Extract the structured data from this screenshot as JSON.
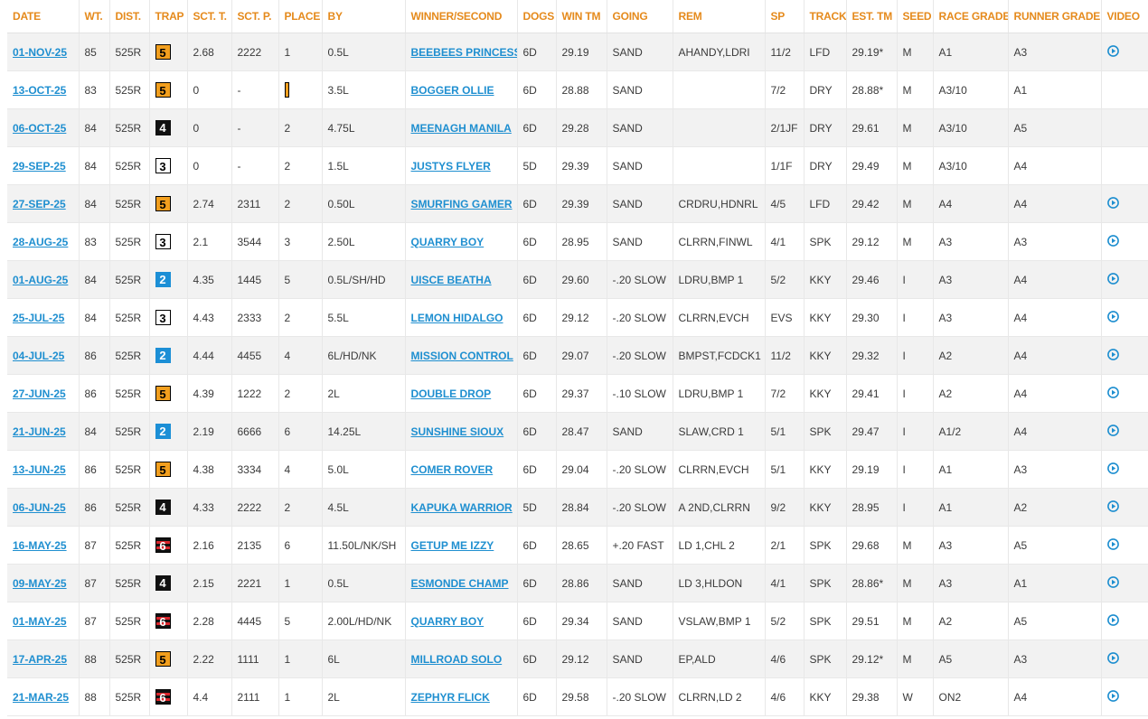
{
  "columns": [
    "DATE",
    "WT.",
    "DIST.",
    "TRAP",
    "SCT. T.",
    "SCT. P.",
    "PLACE",
    "BY",
    "WINNER/SECOND",
    "DOGS",
    "WIN TM",
    "GOING",
    "REM",
    "SP",
    "TRACK",
    "EST. TM",
    "SEED",
    "RACE GRADE",
    "RUNNER GRADE",
    "VIDEO"
  ],
  "colors": {
    "header": "#e58a1c",
    "link": "#1f8fd0",
    "video_icon": "#1f8fd0"
  },
  "rows": [
    {
      "date": "01-NOV-25",
      "wt": "85",
      "dist": "525R",
      "trap": "5",
      "sct_t": "2.68",
      "sct_p": "2222",
      "place": "1",
      "by": "0.5L",
      "winner": "BEEBEES PRINCESS",
      "dogs": "6D",
      "win_tm": "29.19",
      "going": "SAND",
      "rem": "AHANDY,LDRI",
      "sp": "11/2",
      "track": "LFD",
      "est_tm": "29.19*",
      "seed": "M",
      "race_grade": "A1",
      "runner_grade": "A3",
      "video": true
    },
    {
      "date": "13-OCT-25",
      "wt": "83",
      "dist": "525R",
      "trap": "5",
      "sct_t": "0",
      "sct_p": "-",
      "place": "",
      "place_icon": "partial-trap",
      "by": "3.5L",
      "winner": "BOGGER OLLIE",
      "dogs": "6D",
      "win_tm": "28.88",
      "going": "SAND",
      "rem": "",
      "sp": "7/2",
      "track": "DRY",
      "est_tm": "28.88*",
      "seed": "M",
      "race_grade": "A3/10",
      "runner_grade": "A1",
      "video": false
    },
    {
      "date": "06-OCT-25",
      "wt": "84",
      "dist": "525R",
      "trap": "4",
      "sct_t": "0",
      "sct_p": "-",
      "place": "2",
      "by": "4.75L",
      "winner": "MEENAGH MANILA",
      "dogs": "6D",
      "win_tm": "29.28",
      "going": "SAND",
      "rem": "",
      "sp": "2/1JF",
      "track": "DRY",
      "est_tm": "29.61",
      "seed": "M",
      "race_grade": "A3/10",
      "runner_grade": "A5",
      "video": false
    },
    {
      "date": "29-SEP-25",
      "wt": "84",
      "dist": "525R",
      "trap": "3",
      "sct_t": "0",
      "sct_p": "-",
      "place": "2",
      "by": "1.5L",
      "winner": "JUSTYS FLYER",
      "dogs": "5D",
      "win_tm": "29.39",
      "going": "SAND",
      "rem": "",
      "sp": "1/1F",
      "track": "DRY",
      "est_tm": "29.49",
      "seed": "M",
      "race_grade": "A3/10",
      "runner_grade": "A4",
      "video": false
    },
    {
      "date": "27-SEP-25",
      "wt": "84",
      "dist": "525R",
      "trap": "5",
      "sct_t": "2.74",
      "sct_p": "2311",
      "place": "2",
      "by": "0.50L",
      "winner": "SMURFING GAMER",
      "dogs": "6D",
      "win_tm": "29.39",
      "going": "SAND",
      "rem": "CRDRU,HDNRL",
      "sp": "4/5",
      "track": "LFD",
      "est_tm": "29.42",
      "seed": "M",
      "race_grade": "A4",
      "runner_grade": "A4",
      "video": true
    },
    {
      "date": "28-AUG-25",
      "wt": "83",
      "dist": "525R",
      "trap": "3",
      "sct_t": "2.1",
      "sct_p": "3544",
      "place": "3",
      "by": "2.50L",
      "winner": "QUARRY BOY",
      "dogs": "6D",
      "win_tm": "28.95",
      "going": "SAND",
      "rem": "CLRRN,FINWL",
      "sp": "4/1",
      "track": "SPK",
      "est_tm": "29.12",
      "seed": "M",
      "race_grade": "A3",
      "runner_grade": "A3",
      "video": true
    },
    {
      "date": "01-AUG-25",
      "wt": "84",
      "dist": "525R",
      "trap": "2",
      "sct_t": "4.35",
      "sct_p": "1445",
      "place": "5",
      "by": "0.5L/SH/HD",
      "winner": "UISCE BEATHA",
      "dogs": "6D",
      "win_tm": "29.60",
      "going": "-.20 SLOW",
      "rem": "LDRU,BMP 1",
      "sp": "5/2",
      "track": "KKY",
      "est_tm": "29.46",
      "seed": "I",
      "race_grade": "A3",
      "runner_grade": "A4",
      "video": true
    },
    {
      "date": "25-JUL-25",
      "wt": "84",
      "dist": "525R",
      "trap": "3",
      "sct_t": "4.43",
      "sct_p": "2333",
      "place": "2",
      "by": "5.5L",
      "winner": "LEMON HIDALGO",
      "dogs": "6D",
      "win_tm": "29.12",
      "going": "-.20 SLOW",
      "rem": "CLRRN,EVCH",
      "sp": "EVS",
      "track": "KKY",
      "est_tm": "29.30",
      "seed": "I",
      "race_grade": "A3",
      "runner_grade": "A4",
      "video": true
    },
    {
      "date": "04-JUL-25",
      "wt": "86",
      "dist": "525R",
      "trap": "2",
      "sct_t": "4.44",
      "sct_p": "4455",
      "place": "4",
      "by": "6L/HD/NK",
      "winner": "MISSION CONTROL",
      "dogs": "6D",
      "win_tm": "29.07",
      "going": "-.20 SLOW",
      "rem": "BMPST,FCDCK1",
      "sp": "11/2",
      "track": "KKY",
      "est_tm": "29.32",
      "seed": "I",
      "race_grade": "A2",
      "runner_grade": "A4",
      "video": true
    },
    {
      "date": "27-JUN-25",
      "wt": "86",
      "dist": "525R",
      "trap": "5",
      "sct_t": "4.39",
      "sct_p": "1222",
      "place": "2",
      "by": "2L",
      "winner": "DOUBLE DROP",
      "dogs": "6D",
      "win_tm": "29.37",
      "going": "-.10 SLOW",
      "rem": "LDRU,BMP 1",
      "sp": "7/2",
      "track": "KKY",
      "est_tm": "29.41",
      "seed": "I",
      "race_grade": "A2",
      "runner_grade": "A4",
      "video": true
    },
    {
      "date": "21-JUN-25",
      "wt": "84",
      "dist": "525R",
      "trap": "2",
      "sct_t": "2.19",
      "sct_p": "6666",
      "place": "6",
      "by": "14.25L",
      "winner": "SUNSHINE SIOUX",
      "dogs": "6D",
      "win_tm": "28.47",
      "going": "SAND",
      "rem": "SLAW,CRD 1",
      "sp": "5/1",
      "track": "SPK",
      "est_tm": "29.47",
      "seed": "I",
      "race_grade": "A1/2",
      "runner_grade": "A4",
      "video": true
    },
    {
      "date": "13-JUN-25",
      "wt": "86",
      "dist": "525R",
      "trap": "5",
      "sct_t": "4.38",
      "sct_p": "3334",
      "place": "4",
      "by": "5.0L",
      "winner": "COMER ROVER",
      "dogs": "6D",
      "win_tm": "29.04",
      "going": "-.20 SLOW",
      "rem": "CLRRN,EVCH",
      "sp": "5/1",
      "track": "KKY",
      "est_tm": "29.19",
      "seed": "I",
      "race_grade": "A1",
      "runner_grade": "A3",
      "video": true
    },
    {
      "date": "06-JUN-25",
      "wt": "86",
      "dist": "525R",
      "trap": "4",
      "sct_t": "4.33",
      "sct_p": "2222",
      "place": "2",
      "by": "4.5L",
      "winner": "KAPUKA WARRIOR",
      "dogs": "5D",
      "win_tm": "28.84",
      "going": "-.20 SLOW",
      "rem": "A 2ND,CLRRN",
      "sp": "9/2",
      "track": "KKY",
      "est_tm": "28.95",
      "seed": "I",
      "race_grade": "A1",
      "runner_grade": "A2",
      "video": true
    },
    {
      "date": "16-MAY-25",
      "wt": "87",
      "dist": "525R",
      "trap": "6",
      "sct_t": "2.16",
      "sct_p": "2135",
      "place": "6",
      "by": "11.50L/NK/SH",
      "winner": "GETUP ME IZZY",
      "dogs": "6D",
      "win_tm": "28.65",
      "going": "+.20 FAST",
      "rem": "LD 1,CHL 2",
      "sp": "2/1",
      "track": "SPK",
      "est_tm": "29.68",
      "seed": "M",
      "race_grade": "A3",
      "runner_grade": "A5",
      "video": true
    },
    {
      "date": "09-MAY-25",
      "wt": "87",
      "dist": "525R",
      "trap": "4",
      "sct_t": "2.15",
      "sct_p": "2221",
      "place": "1",
      "by": "0.5L",
      "winner": "ESMONDE CHAMP",
      "dogs": "6D",
      "win_tm": "28.86",
      "going": "SAND",
      "rem": "LD 3,HLDON",
      "sp": "4/1",
      "track": "SPK",
      "est_tm": "28.86*",
      "seed": "M",
      "race_grade": "A3",
      "runner_grade": "A1",
      "video": true
    },
    {
      "date": "01-MAY-25",
      "wt": "87",
      "dist": "525R",
      "trap": "6",
      "sct_t": "2.28",
      "sct_p": "4445",
      "place": "5",
      "by": "2.00L/HD/NK",
      "winner": "QUARRY BOY",
      "dogs": "6D",
      "win_tm": "29.34",
      "going": "SAND",
      "rem": "VSLAW,BMP 1",
      "sp": "5/2",
      "track": "SPK",
      "est_tm": "29.51",
      "seed": "M",
      "race_grade": "A2",
      "runner_grade": "A5",
      "video": true
    },
    {
      "date": "17-APR-25",
      "wt": "88",
      "dist": "525R",
      "trap": "5",
      "sct_t": "2.22",
      "sct_p": "1111",
      "place": "1",
      "by": "6L",
      "winner": "MILLROAD SOLO",
      "dogs": "6D",
      "win_tm": "29.12",
      "going": "SAND",
      "rem": "EP,ALD",
      "sp": "4/6",
      "track": "SPK",
      "est_tm": "29.12*",
      "seed": "M",
      "race_grade": "A5",
      "runner_grade": "A3",
      "video": true
    },
    {
      "date": "21-MAR-25",
      "wt": "88",
      "dist": "525R",
      "trap": "6",
      "sct_t": "4.4",
      "sct_p": "2111",
      "place": "1",
      "by": "2L",
      "winner": "ZEPHYR FLICK",
      "dogs": "6D",
      "win_tm": "29.58",
      "going": "-.20 SLOW",
      "rem": "CLRRN,LD 2",
      "sp": "4/6",
      "track": "KKY",
      "est_tm": "29.38",
      "seed": "W",
      "race_grade": "ON2",
      "runner_grade": "A4",
      "video": true
    }
  ]
}
